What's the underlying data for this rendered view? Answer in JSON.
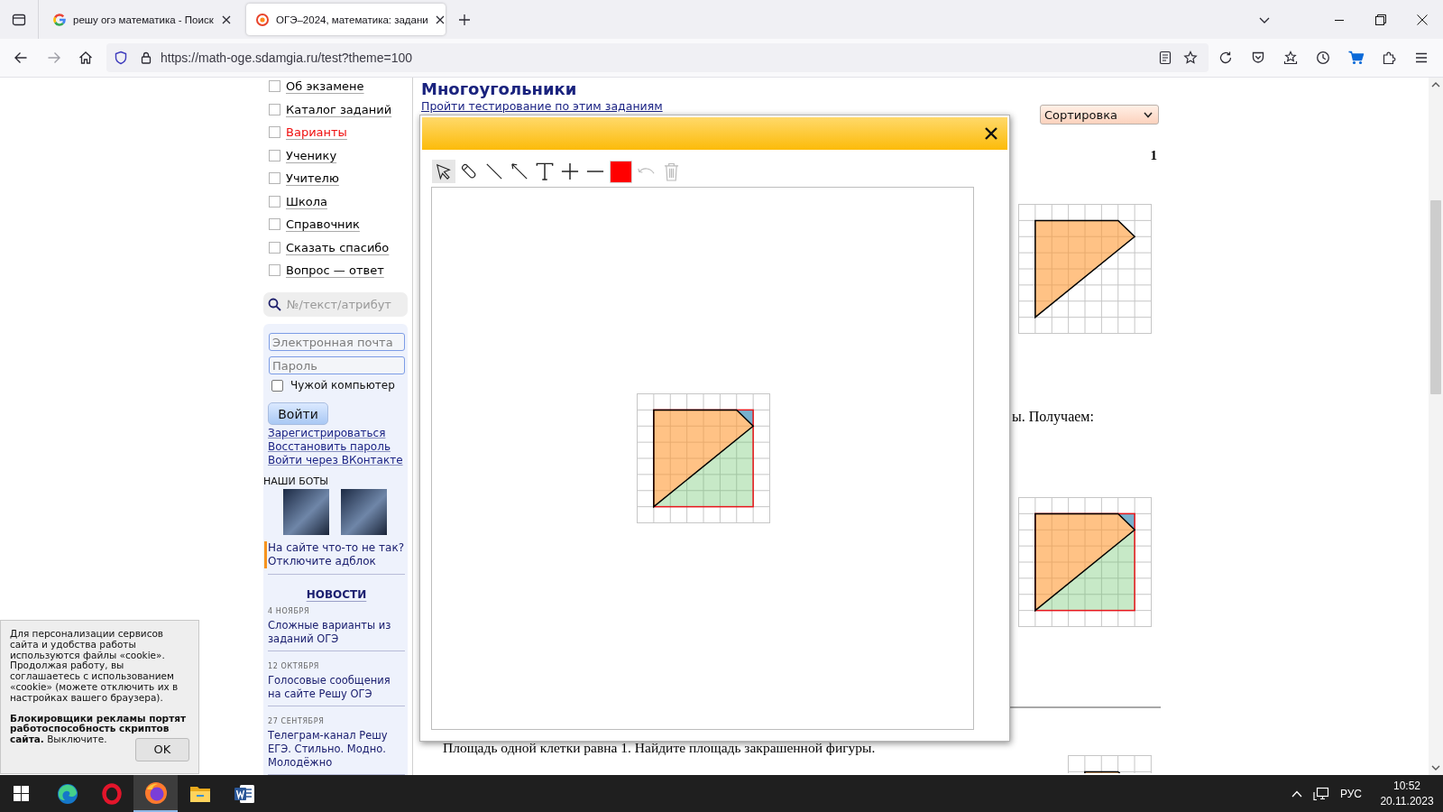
{
  "browser": {
    "tabs": [
      {
        "title": "решу огэ математика - Поиск",
        "selected": false
      },
      {
        "title": "ОГЭ–2024, математика: задани",
        "selected": true
      }
    ],
    "url": "https://math-oge.sdamgia.ru/test?theme=100"
  },
  "sidebar": {
    "menu": [
      {
        "label": "Об экзамене",
        "highlighted": false
      },
      {
        "label": "Каталог заданий",
        "highlighted": false
      },
      {
        "label": "Варианты",
        "highlighted": true
      },
      {
        "label": "Ученику",
        "highlighted": false
      },
      {
        "label": "Учителю",
        "highlighted": false
      },
      {
        "label": "Школа",
        "highlighted": false
      },
      {
        "label": "Справочник",
        "highlighted": false
      },
      {
        "label": "Сказать спасибо",
        "highlighted": false
      },
      {
        "label": "Вопрос — ответ",
        "highlighted": false
      }
    ],
    "search": {
      "placeholder": "№/текст/атрибут"
    },
    "login": {
      "email": {
        "placeholder": "Электронная почта"
      },
      "password": {
        "placeholder": "Пароль"
      },
      "remember": {
        "label": "Чужой компьютер",
        "checked": false
      },
      "submit": "Войти",
      "links": [
        "Зарегистрироваться",
        "Восстановить пароль",
        "Войти через ВКонтакте"
      ]
    },
    "bots": {
      "heading": "НАШИ БОТЫ"
    },
    "notice": "На сайте что-то не так? Отключите адблок",
    "news": {
      "heading": "НОВОСТИ",
      "items": [
        {
          "date": "4 НОЯБРЯ",
          "title": "Сложные варианты из заданий ОГЭ"
        },
        {
          "date": "12 ОКТЯБРЯ",
          "title": "Голосовые сообщения на сайте Решу ОГЭ"
        },
        {
          "date": "27 СЕНТЯБРЯ",
          "title": "Телеграм-канал Решу ЕГЭ. Стильно. Модно. Молодёжно"
        }
      ]
    }
  },
  "page": {
    "title": "Многоугольники",
    "test_link": "Пройти тестирование по этим заданиям",
    "sort": {
      "value": "Сортировка"
    },
    "task": {
      "number": "1",
      "figure": {
        "kind": "outline"
      },
      "solution_text": "ы. Получаем:",
      "solution_figure": {
        "kind": "solution"
      }
    },
    "next_task": {
      "text": "Площадь одной клетки равна 1. Найдите площадь закрашенной фигуры.",
      "figure": {
        "kind": "top_part"
      }
    }
  },
  "drawing_modal": {
    "tools": [
      {
        "kind": "select",
        "selected": true,
        "disabled": false
      },
      {
        "kind": "pencil",
        "selected": false,
        "disabled": false
      },
      {
        "kind": "line",
        "selected": false,
        "disabled": false
      },
      {
        "kind": "arrow",
        "selected": false,
        "disabled": false
      },
      {
        "kind": "text",
        "selected": false,
        "disabled": false
      },
      {
        "kind": "plus",
        "selected": false,
        "disabled": false
      },
      {
        "kind": "minus",
        "selected": false,
        "disabled": false
      },
      {
        "kind": "color",
        "color": "#ff0000",
        "selected": false,
        "disabled": false
      },
      {
        "kind": "undo",
        "selected": false,
        "disabled": true
      },
      {
        "kind": "delete",
        "selected": false,
        "disabled": true
      }
    ],
    "canvas": {
      "figure": {
        "kind": "solution"
      }
    }
  },
  "cookie_notice": {
    "text": "Для персонализации сервисов сайта и удобства работы используются файлы «cookie». Продолжая работу, вы соглашаетесь с использованием «cookie» (можете отключить их в настройках вашего браузера).",
    "warning": "**Блокировщики рекламы портят работоспособность скриптов сайта.** Выключите.",
    "button": "OK"
  },
  "taskbar": {
    "apps": [
      {
        "selected": false
      },
      {
        "selected": false
      },
      {
        "selected": false
      },
      {
        "selected": true
      },
      {
        "selected": false
      },
      {
        "selected": false
      }
    ],
    "language": "РУС",
    "time": "10:52",
    "date": "20.11.2023"
  }
}
